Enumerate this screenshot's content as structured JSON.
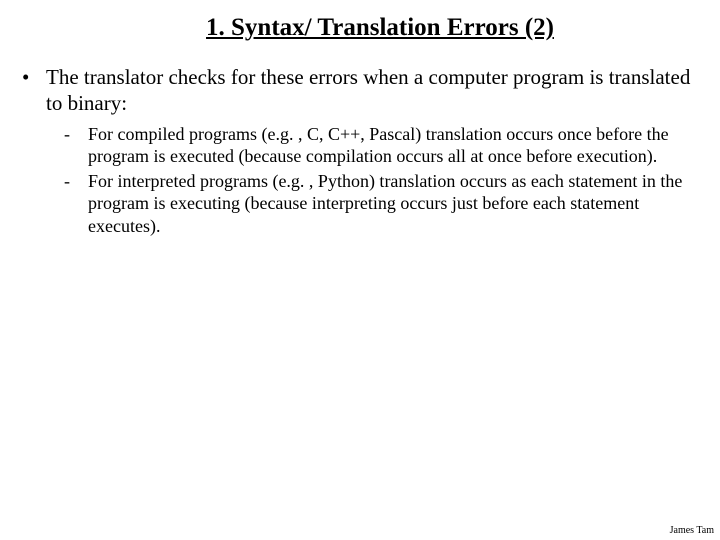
{
  "title": "1.   Syntax/ Translation Errors (2)",
  "main_bullet": "The translator checks for these errors when a computer program is translated to binary:",
  "sub_bullets": [
    "For compiled programs (e.g. , C, C++, Pascal) translation occurs once before the program is executed (because compilation occurs all at once before execution).",
    "For interpreted programs (e.g. , Python) translation occurs as each statement in the program is executing (because interpreting occurs just before each statement executes)."
  ],
  "footer": "James Tam"
}
